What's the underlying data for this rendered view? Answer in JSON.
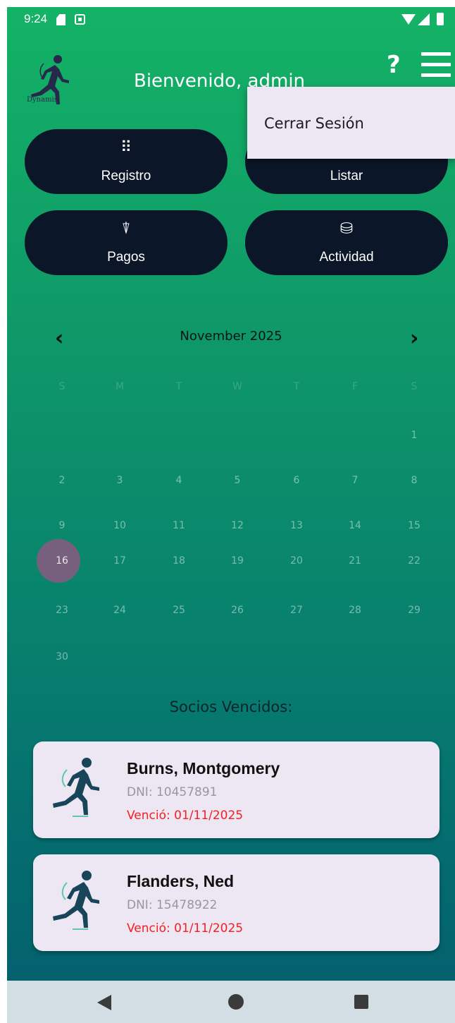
{
  "status_bar": {
    "time": "9:24"
  },
  "header": {
    "logo_text": "Dynamis",
    "welcome": "Bienvenido, admin",
    "help_label": "?"
  },
  "menu": {
    "items": [
      "Cerrar Sesión"
    ]
  },
  "actions": {
    "registro": {
      "label": "Registro",
      "icon": "dialpad-icon"
    },
    "listar": {
      "label": "Listar",
      "icon": "list-icon"
    },
    "pagos": {
      "label": "Pagos",
      "icon": "payment-icon"
    },
    "actividad": {
      "label": "Actividad",
      "icon": "activity-icon"
    }
  },
  "calendar": {
    "month_title": "November 2025",
    "prev_label": "‹",
    "next_label": "›",
    "weekdays": [
      "S",
      "M",
      "T",
      "W",
      "T",
      "F",
      "S"
    ],
    "weeks": [
      [
        "",
        "",
        "",
        "",
        "",
        "",
        "1"
      ],
      [
        "2",
        "3",
        "4",
        "5",
        "6",
        "7",
        "8"
      ],
      [
        "9",
        "10",
        "11",
        "12",
        "13",
        "14",
        "15"
      ],
      [
        "16",
        "17",
        "18",
        "19",
        "20",
        "21",
        "22"
      ],
      [
        "23",
        "24",
        "25",
        "26",
        "27",
        "28",
        "29"
      ],
      [
        "30",
        "",
        "",
        "",
        "",
        "",
        ""
      ]
    ],
    "selected_day": "16"
  },
  "expired_section": {
    "title": "Socios Vencidos:",
    "members": [
      {
        "name": "Burns, Montgomery",
        "dni": "DNI: 10457891",
        "expired": "Venció: 01/11/2025"
      },
      {
        "name": "Flanders, Ned",
        "dni": "DNI: 15478922",
        "expired": "Venció: 01/11/2025"
      }
    ]
  },
  "colors": {
    "gradient_top": "#14b266",
    "gradient_bottom": "#045e6e",
    "button_bg": "#0b1628",
    "card_bg": "#ede6f3",
    "expired_text": "#f42020",
    "today_circle": "#77607d"
  }
}
